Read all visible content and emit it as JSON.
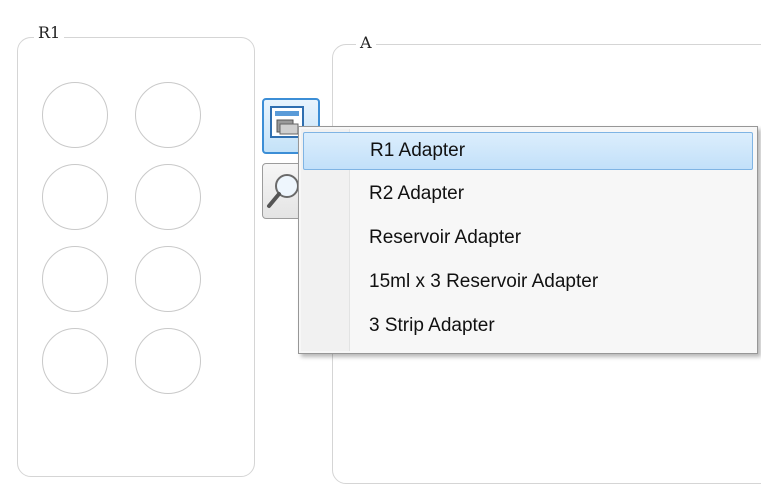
{
  "groups": {
    "r1_title": "R1",
    "a_title": "A"
  },
  "tools": {
    "adapter_icon": "tray-adapter-icon",
    "search_icon": "magnifier-icon"
  },
  "menu": {
    "items": [
      {
        "label": "R1 Adapter",
        "selected": true
      },
      {
        "label": "R2 Adapter",
        "selected": false
      },
      {
        "label": "Reservoir Adapter",
        "selected": false
      },
      {
        "label": "15ml x 3 Reservoir Adapter",
        "selected": false
      },
      {
        "label": "3 Strip Adapter",
        "selected": false
      }
    ]
  },
  "colors": {
    "accent": "#3c8ed6",
    "selection_bg": "#c8e3fa",
    "border": "#d5d5d5"
  }
}
